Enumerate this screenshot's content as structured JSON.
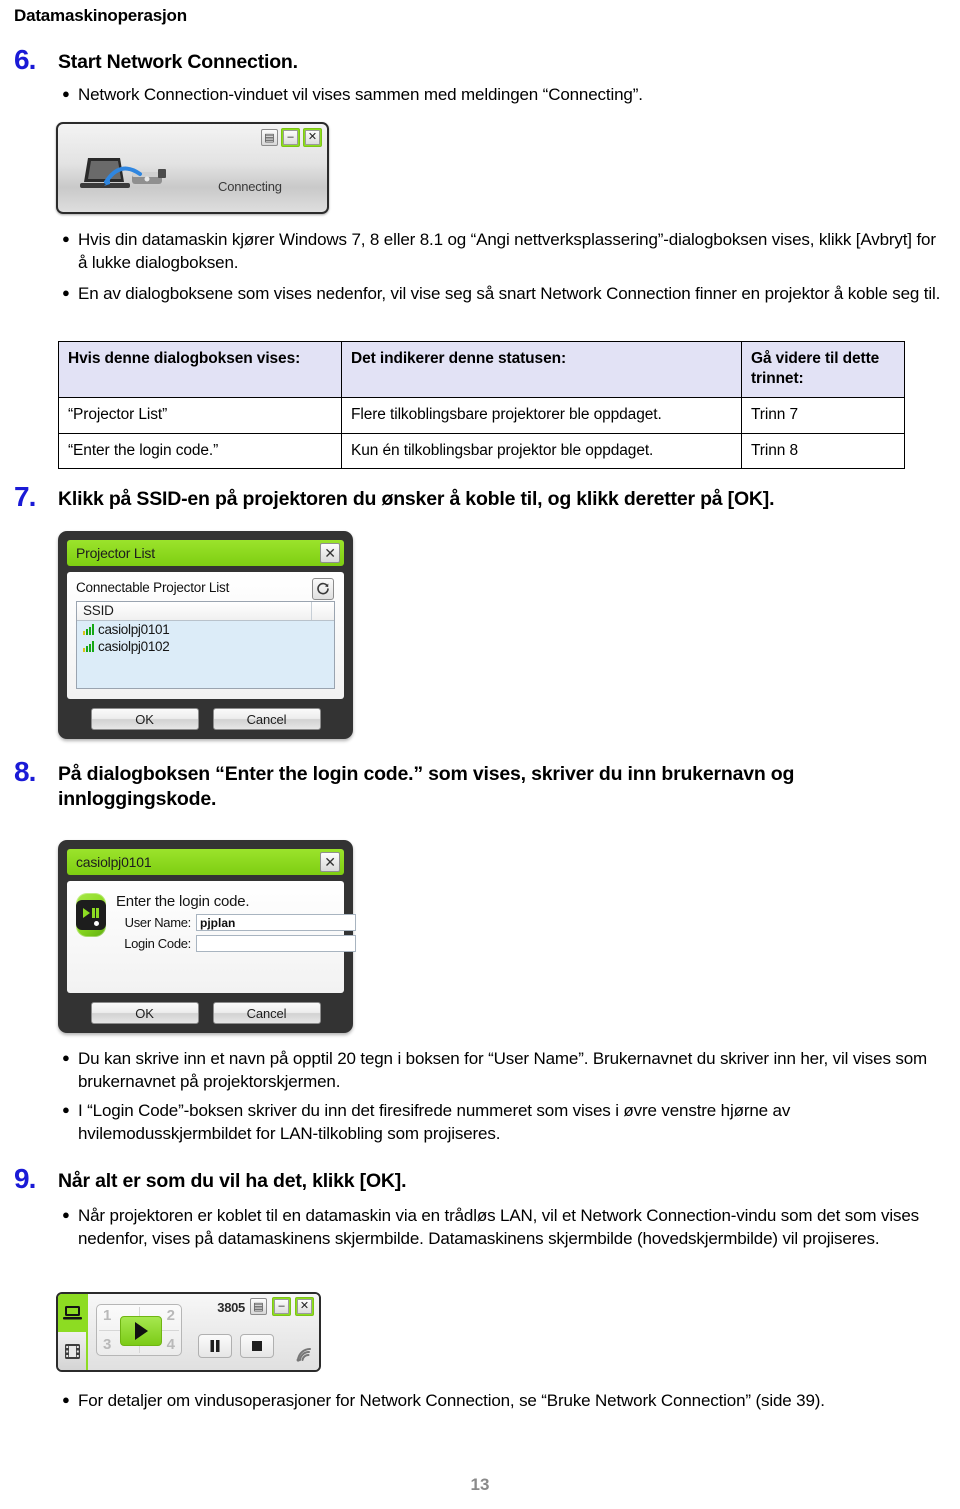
{
  "running_head": "Datamaskinoperasjon",
  "page_number": "13",
  "steps": [
    {
      "number": "6.",
      "title": "Start Network Connection.",
      "bullets": [
        "Network Connection-vinduet vil vises sammen med meldingen “Connecting”.",
        "Hvis din datamaskin kjører Windows 7, 8 eller 8.1 og “Angi nettverksplassering”-dialogboksen vises, klikk [Avbryt] for å lukke dialogboksen.",
        "En av dialogboksene som vises nedenfor, vil vise seg så snart Network Connection finner en projektor å koble seg til."
      ]
    },
    {
      "number": "7.",
      "title": "Klikk på SSID-en på projektoren du ønsker å koble til, og klikk deretter på [OK]."
    },
    {
      "number": "8.",
      "title": "På dialogboksen “Enter the login code.” som vises, skriver du inn brukernavn og innloggingskode.",
      "bullets": [
        "Du kan skrive inn et navn på opptil 20 tegn i boksen for “User Name”. Brukernavnet du skriver inn her, vil vises som brukernavnet på projektorskjermen.",
        "I “Login Code”-boksen skriver du inn det firesifrede nummeret som vises i øvre venstre hjørne av hvilemodusskjermbildet for LAN-tilkobling som projiseres."
      ]
    },
    {
      "number": "9.",
      "title": "Når alt er som du vil ha det, klikk [OK].",
      "bullets": [
        "Når projektoren er koblet til en datamaskin via en trådløs LAN, vil et Network Connection-vindu som det som vises nedenfor, vises på datamaskinens skjermbilde. Datamaskinens skjermbilde (hovedskjermbilde) vil projiseres.",
        "For detaljer om vindusoperasjoner for Network Connection, se “Bruke Network Connection” (side 39)."
      ]
    }
  ],
  "table": {
    "headers": [
      "Hvis denne dialogboksen vises:",
      "Det indikerer denne statusen:",
      "Gå videre til dette trinnet:"
    ],
    "rows": [
      [
        "“Projector List”",
        "Flere tilkoblingsbare projektorer ble oppdaget.",
        "Trinn 7"
      ],
      [
        "“Enter the login code.”",
        "Kun én tilkoblingsbar projektor ble oppdaget.",
        "Trinn 8"
      ]
    ]
  },
  "connecting_window": {
    "status_label": "Connecting",
    "list_icon": "list-icon",
    "minimize_label": "–",
    "close_label": "✕",
    "computer_icon": "computer-projector-icon"
  },
  "projector_list_dialog": {
    "title": "Projector List",
    "close_label": "✕",
    "section_label": "Connectable Projector List",
    "refresh_icon": "refresh-icon",
    "column_header": "SSID",
    "items": [
      "casiolpj0101",
      "casiolpj0102"
    ],
    "ok_label": "OK",
    "cancel_label": "Cancel"
  },
  "login_dialog": {
    "title": "casiolpj0101",
    "close_label": "✕",
    "app_icon": "projector-app-icon",
    "prompt": "Enter the login code.",
    "user_name_label": "User Name:",
    "user_name_value": "pjplan",
    "login_code_label": "Login Code:",
    "login_code_value": "",
    "ok_label": "OK",
    "cancel_label": "Cancel"
  },
  "network_toolbar": {
    "counter": "3805",
    "quadrants": [
      "1",
      "2",
      "3",
      "4"
    ],
    "monitor_icon": "monitor-icon",
    "film_icon": "film-icon",
    "play_icon": "play-icon",
    "pause_icon": "pause-icon",
    "stop_icon": "stop-icon",
    "wifi_icon": "wifi-icon",
    "list_icon": "list-icon",
    "minimize_label": "–",
    "close_label": "✕"
  },
  "colors": {
    "step_number": "#1a1ad6",
    "accent_green": "#8ede1d",
    "table_header_bg": "#e2e2f5",
    "list_selection_bg": "#dcecf8"
  }
}
